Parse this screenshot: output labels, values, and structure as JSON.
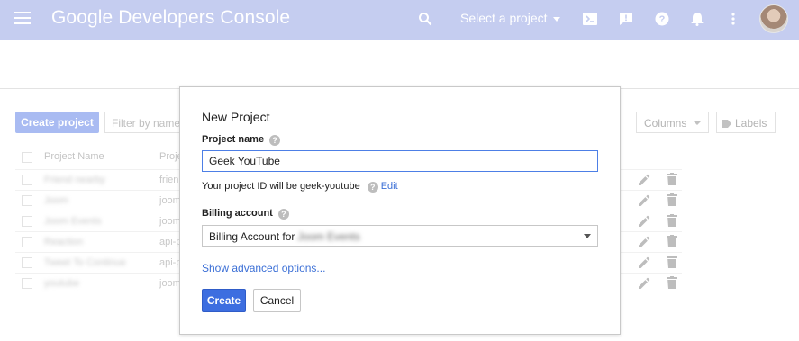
{
  "header": {
    "menu_icon": "hamburger-menu-icon",
    "title": "Google Developers Console",
    "select_project_label": "Select a project",
    "icons": [
      "search-icon",
      "cloud-shell-icon",
      "feedback-icon",
      "help-icon",
      "notifications-icon",
      "more-vert-icon",
      "avatar"
    ],
    "bar_color": "#c5cdf0"
  },
  "projects_page": {
    "create_button": "Create project",
    "filter_placeholder": "Filter by name",
    "columns_button": "Columns",
    "labels_button": "Labels",
    "table": {
      "columns": [
        "Project Name",
        "Project ID"
      ],
      "rows": [
        {
          "name": "Friend nearby",
          "id": "frien"
        },
        {
          "name": "Joom",
          "id": "joom"
        },
        {
          "name": "Joom Events",
          "id": "joom"
        },
        {
          "name": "Reaction",
          "id": "api-p"
        },
        {
          "name": "Tweet To Continue",
          "id": "api-p"
        },
        {
          "name": "youtube",
          "id": "joom"
        }
      ]
    }
  },
  "dialog": {
    "title": "New Project",
    "project_name_label": "Project name",
    "project_name_value": "Geek YouTube",
    "project_id_prefix": "Your project ID will be geek-youtube",
    "edit_link": "Edit",
    "billing_label": "Billing account",
    "billing_prefix": "Billing Account for",
    "billing_account_name": "Joom Events",
    "advanced_link": "Show advanced options...",
    "create_button": "Create",
    "cancel_button": "Cancel",
    "primary_color": "#3d6ee0",
    "link_color": "#3b6fd6"
  }
}
